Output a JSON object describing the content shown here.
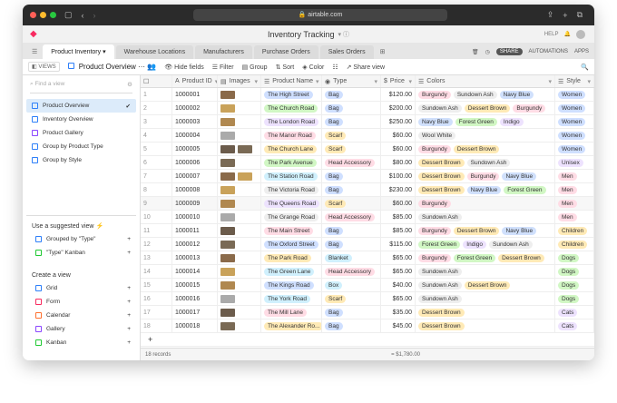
{
  "browser": {
    "url": "airtable.com"
  },
  "app": {
    "title": "Inventory Tracking",
    "help": "HELP",
    "share": "SHARE",
    "automations": "AUTOMATIONS",
    "apps": "APPS"
  },
  "tabs": [
    "Product Inventory",
    "Warehouse Locations",
    "Manufacturers",
    "Purchase Orders",
    "Sales Orders"
  ],
  "toolbar": {
    "views": "VIEWS",
    "current_view": "Product Overview",
    "hide_fields": "Hide fields",
    "filter": "Filter",
    "group": "Group",
    "sort": "Sort",
    "color": "Color",
    "share_view": "Share view"
  },
  "sidebar": {
    "search_placeholder": "Find a view",
    "views": [
      "Product Overview",
      "Inventory Overview",
      "Product Gallery",
      "Group by Product Type",
      "Group by Style"
    ],
    "suggested_title": "Use a suggested view",
    "suggested": [
      "Grouped by \"Type\"",
      "\"Type\" Kanban"
    ],
    "create_title": "Create a view",
    "create": [
      "Grid",
      "Form",
      "Calendar",
      "Gallery",
      "Kanban"
    ]
  },
  "colors": {
    "Burgundy": "#ffdce5",
    "Sundown Ash": "#eeeeee",
    "Navy Blue": "#d0e0fc",
    "Dessert Brown": "#ffeab6",
    "Forest Green": "#d1f7c4",
    "Indigo": "#ede2fe",
    "Wool White": "#eeeeee",
    "Bag": "#cfdfff",
    "Scarf": "#ffeab6",
    "Head Accessory": "#ffdce5",
    "Blanket": "#d0f0fd",
    "Box": "#d0f0fd",
    "Women": "#cfdfff",
    "Unisex": "#ede2fe",
    "Men": "#ffdce5",
    "Children": "#ffeab6",
    "Dogs": "#d1f7c4",
    "Cats": "#ede2fe"
  },
  "grid": {
    "columns": [
      "Product ID",
      "Images",
      "Product Name",
      "Type",
      "Price",
      "Colors",
      "Style"
    ],
    "rows": [
      {
        "n": "1",
        "id": "1000001",
        "imgs": 1,
        "name": "The High Street",
        "nc": "#cfdfff",
        "type": "Bag",
        "price": "$120.00",
        "colors": [
          "Burgundy",
          "Sundown Ash",
          "Navy Blue"
        ],
        "style": "Women"
      },
      {
        "n": "2",
        "id": "1000002",
        "imgs": 1,
        "name": "The Church Road",
        "nc": "#d1f7c4",
        "type": "Bag",
        "price": "$200.00",
        "colors": [
          "Sundown Ash",
          "Dessert Brown",
          "Burgundy"
        ],
        "style": "Women"
      },
      {
        "n": "3",
        "id": "1000003",
        "imgs": 1,
        "name": "The London Road",
        "nc": "#ede2fe",
        "type": "Bag",
        "price": "$250.00",
        "colors": [
          "Navy Blue",
          "Forest Green",
          "Indigo"
        ],
        "style": "Women"
      },
      {
        "n": "4",
        "id": "1000004",
        "imgs": 1,
        "name": "The Manor Road",
        "nc": "#ffdce5",
        "type": "Scarf",
        "price": "$60.00",
        "colors": [
          "Wool White"
        ],
        "style": "Women"
      },
      {
        "n": "5",
        "id": "1000005",
        "imgs": 2,
        "name": "The Church Lane",
        "nc": "#ffeab6",
        "type": "Scarf",
        "price": "$60.00",
        "colors": [
          "Burgundy",
          "Dessert Brown"
        ],
        "style": "Women"
      },
      {
        "n": "6",
        "id": "1000006",
        "imgs": 1,
        "name": "The Park Avenue",
        "nc": "#d1f7c4",
        "type": "Head Accessory",
        "price": "$80.00",
        "colors": [
          "Dessert Brown",
          "Sundown Ash"
        ],
        "style": "Unisex"
      },
      {
        "n": "7",
        "id": "1000007",
        "imgs": 2,
        "name": "The Station Road",
        "nc": "#d0f0fd",
        "type": "Bag",
        "price": "$100.00",
        "colors": [
          "Dessert Brown",
          "Burgundy",
          "Navy Blue"
        ],
        "style": "Men"
      },
      {
        "n": "8",
        "id": "1000008",
        "imgs": 1,
        "name": "The Victoria Road",
        "nc": "#eeeeee",
        "type": "Bag",
        "price": "$230.00",
        "colors": [
          "Dessert Brown",
          "Navy Blue",
          "Forest Green"
        ],
        "style": "Men"
      },
      {
        "n": "9",
        "id": "1000009",
        "imgs": 1,
        "name": "The Queens Road",
        "nc": "#ede2fe",
        "type": "Scarf",
        "price": "$60.00",
        "colors": [
          "Burgundy"
        ],
        "style": "Men"
      },
      {
        "n": "10",
        "id": "1000010",
        "imgs": 1,
        "name": "The Grange Road",
        "nc": "#eeeeee",
        "type": "Head Accessory",
        "price": "$85.00",
        "colors": [
          "Sundown Ash"
        ],
        "style": "Men"
      },
      {
        "n": "11",
        "id": "1000011",
        "imgs": 1,
        "name": "The Main Street",
        "nc": "#ffdce5",
        "type": "Bag",
        "price": "$85.00",
        "colors": [
          "Burgundy",
          "Dessert Brown",
          "Navy Blue"
        ],
        "style": "Children"
      },
      {
        "n": "12",
        "id": "1000012",
        "imgs": 1,
        "name": "The Oxford Street",
        "nc": "#cfdfff",
        "type": "Bag",
        "price": "$115.00",
        "colors": [
          "Forest Green",
          "Indigo",
          "Sundown Ash"
        ],
        "style": "Children"
      },
      {
        "n": "13",
        "id": "1000013",
        "imgs": 1,
        "name": "The Park Road",
        "nc": "#ffeab6",
        "type": "Blanket",
        "price": "$65.00",
        "colors": [
          "Burgundy",
          "Forest Green",
          "Dessert Brown"
        ],
        "style": "Dogs"
      },
      {
        "n": "14",
        "id": "1000014",
        "imgs": 1,
        "name": "The Green Lane",
        "nc": "#d0f0fd",
        "type": "Head Accessory",
        "price": "$65.00",
        "colors": [
          "Sundown Ash"
        ],
        "style": "Dogs"
      },
      {
        "n": "15",
        "id": "1000015",
        "imgs": 1,
        "name": "The Kings Road",
        "nc": "#cfdfff",
        "type": "Box",
        "price": "$40.00",
        "colors": [
          "Sundown Ash",
          "Dessert Brown"
        ],
        "style": "Dogs"
      },
      {
        "n": "16",
        "id": "1000016",
        "imgs": 1,
        "name": "The York Road",
        "nc": "#d0f0fd",
        "type": "Scarf",
        "price": "$65.00",
        "colors": [
          "Sundown Ash"
        ],
        "style": "Dogs"
      },
      {
        "n": "17",
        "id": "1000017",
        "imgs": 1,
        "name": "The Mill Lane",
        "nc": "#ffdce5",
        "type": "Bag",
        "price": "$35.00",
        "colors": [
          "Dessert Brown"
        ],
        "style": "Cats"
      },
      {
        "n": "18",
        "id": "1000018",
        "imgs": 1,
        "name": "The Alexander Ro...",
        "nc": "#ffeab6",
        "type": "Bag",
        "price": "$45.00",
        "colors": [
          "Dessert Brown"
        ],
        "style": "Cats"
      }
    ],
    "records": "18 records",
    "sum": "= $1,780.00"
  }
}
